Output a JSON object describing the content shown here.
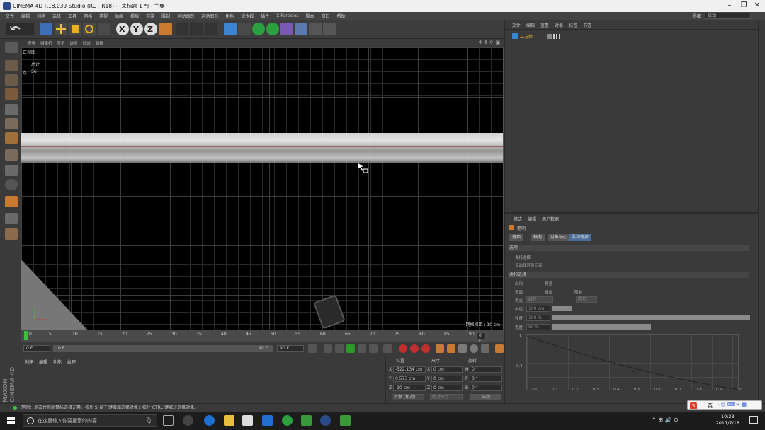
{
  "window": {
    "title": "CINEMA 4D R18.039 Studio (RC - R18) - [未标题 1 *] - 主要"
  },
  "menubar": {
    "items": [
      "文件",
      "编辑",
      "创建",
      "选择",
      "工具",
      "网格",
      "捕捉",
      "动画",
      "模拟",
      "渲染",
      "雕刻",
      "运动跟踪",
      "运动图形",
      "角色",
      "流水线",
      "插件",
      "X-Particles",
      "脚本",
      "窗口",
      "帮助"
    ],
    "layout_label": "界面",
    "layout_value": "启动"
  },
  "viewport": {
    "menu": [
      "查看",
      "摄像机",
      "显示",
      "选项",
      "过滤",
      "面板"
    ],
    "view_name": "正视图",
    "stats_label": "总计",
    "points_label": "点",
    "points_value": "56",
    "grid_label": "网格间距 : 10 cm"
  },
  "timeline": {
    "ticks": [
      "0",
      "5",
      "10",
      "15",
      "20",
      "25",
      "30",
      "35",
      "40",
      "45",
      "50",
      "55",
      "60",
      "65",
      "70",
      "75",
      "80",
      "85",
      "90"
    ],
    "current_frame": "0 F",
    "frame_display": "0 F",
    "start_field": "0 F",
    "range_start": "0 F",
    "range_end": "90 F",
    "end_field": "90 F"
  },
  "material_manager": {
    "menu": [
      "创建",
      "编辑",
      "功能",
      "纹理"
    ]
  },
  "coordinates": {
    "headers": [
      "位置",
      "尺寸",
      "旋转"
    ],
    "rows": [
      {
        "axis": "X",
        "pos": "-522.134 cm",
        "size_axis": "X",
        "size": "0 cm",
        "rot_axis": "H",
        "rot": "0 °"
      },
      {
        "axis": "Y",
        "pos": "0.573 cm",
        "size_axis": "Y",
        "size": "0 cm",
        "rot_axis": "P",
        "rot": "0 °"
      },
      {
        "axis": "Z",
        "pos": "-10 cm",
        "size_axis": "Z",
        "size": "0 cm",
        "rot_axis": "B",
        "rot": "0 °"
      }
    ],
    "mode_select": "对象 (相对)",
    "size_select": "绝对尺寸",
    "apply_label": "应用"
  },
  "object_manager": {
    "menu": [
      "文件",
      "编辑",
      "查看",
      "对象",
      "标签",
      "书签"
    ],
    "object_name": "立方体"
  },
  "attributes": {
    "menu": [
      "模式",
      "编辑",
      "用户数据"
    ],
    "tool_name": "笔刷",
    "tabs": [
      "选项",
      "轴向",
      "对象轴心",
      "柔和选择"
    ],
    "section_options": "选项",
    "opt1": "仅选择可见元素",
    "opt2": "保持选择",
    "section_soft": "柔和选择",
    "soft_props": [
      "启用",
      "预览",
      "表面",
      "橡皮",
      "限制",
      "模式",
      "半径",
      "强度",
      "宽度"
    ],
    "mode_value": "线性",
    "shape_value": "圆形",
    "radius_value": "100 cm",
    "strength_value": "100 %",
    "width_value": "50 %",
    "graph_y": [
      "1",
      "0.4"
    ],
    "graph_x": [
      "0.0",
      "0.1",
      "0.2",
      "0.3",
      "0.4",
      "0.5",
      "0.6",
      "0.7",
      "0.8",
      "0.9",
      "1.0"
    ]
  },
  "status": {
    "text": "笔刷：点击并拖动鼠标选择元素。按住 SHIFT 键增加选择对象；按住 CTRL 键减少选择对象。"
  },
  "taskbar": {
    "search_placeholder": "在这里输入你要搜索的内容",
    "time": "10:28",
    "date": "2017/7/18",
    "ime": "英"
  },
  "colors": {
    "accent": "#3cc03c",
    "axis_green": "#2e9a2e",
    "tab_active": "#4a6d9a"
  }
}
